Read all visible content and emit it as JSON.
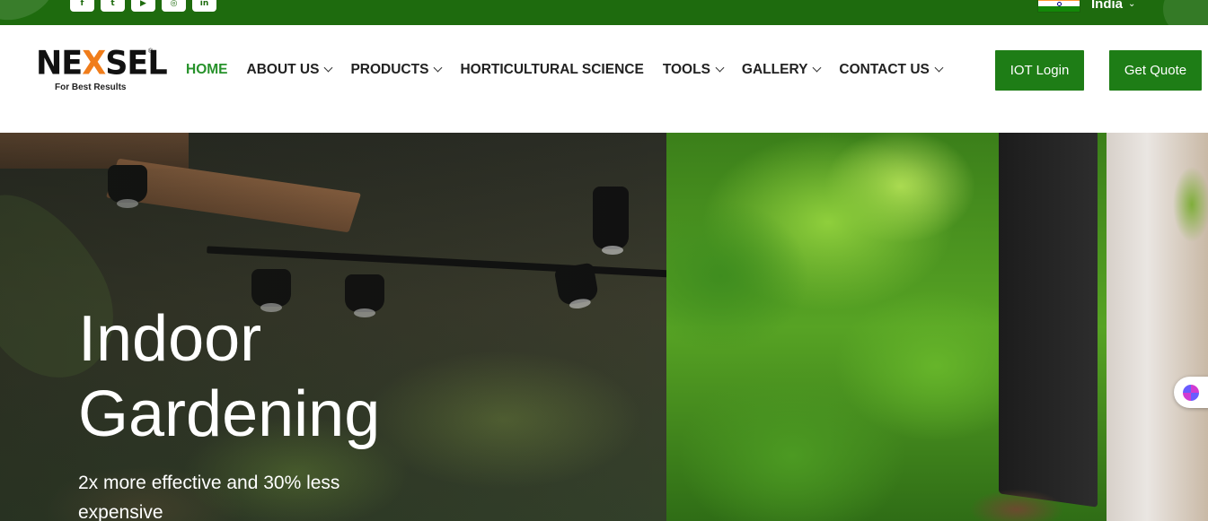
{
  "topbar": {
    "social_icons": [
      "facebook-icon",
      "twitter-icon",
      "youtube-icon",
      "instagram-icon",
      "linkedin-icon"
    ],
    "social_glyphs": [
      "f",
      "t",
      "▶",
      "◎",
      "in"
    ],
    "country": "India",
    "colors": {
      "bar": "#1e6b0e"
    }
  },
  "header": {
    "logo": {
      "wordmark_a": "NE",
      "wordmark_x": "X",
      "wordmark_b": "SEL",
      "registered": "®",
      "tagline": "For Best Results"
    },
    "nav": [
      {
        "label": "HOME",
        "active": true,
        "dropdown": false
      },
      {
        "label": "ABOUT US",
        "active": false,
        "dropdown": true
      },
      {
        "label": "PRODUCTS",
        "active": false,
        "dropdown": true
      },
      {
        "label": "HORTICULTURAL SCIENCE",
        "active": false,
        "dropdown": false
      },
      {
        "label": "TOOLS",
        "active": false,
        "dropdown": true
      },
      {
        "label": "GALLERY",
        "active": false,
        "dropdown": true
      },
      {
        "label": "CONTACT US",
        "active": false,
        "dropdown": true
      }
    ],
    "buttons": {
      "iot_login": "IOT Login",
      "get_quote": "Get Quote"
    },
    "colors": {
      "accent": "#1e7d16",
      "active_nav": "#27922b"
    }
  },
  "hero": {
    "title_line1": "Indoor",
    "title_line2": "Gardening",
    "subtitle": "2x more effective and 30% less expensive"
  }
}
